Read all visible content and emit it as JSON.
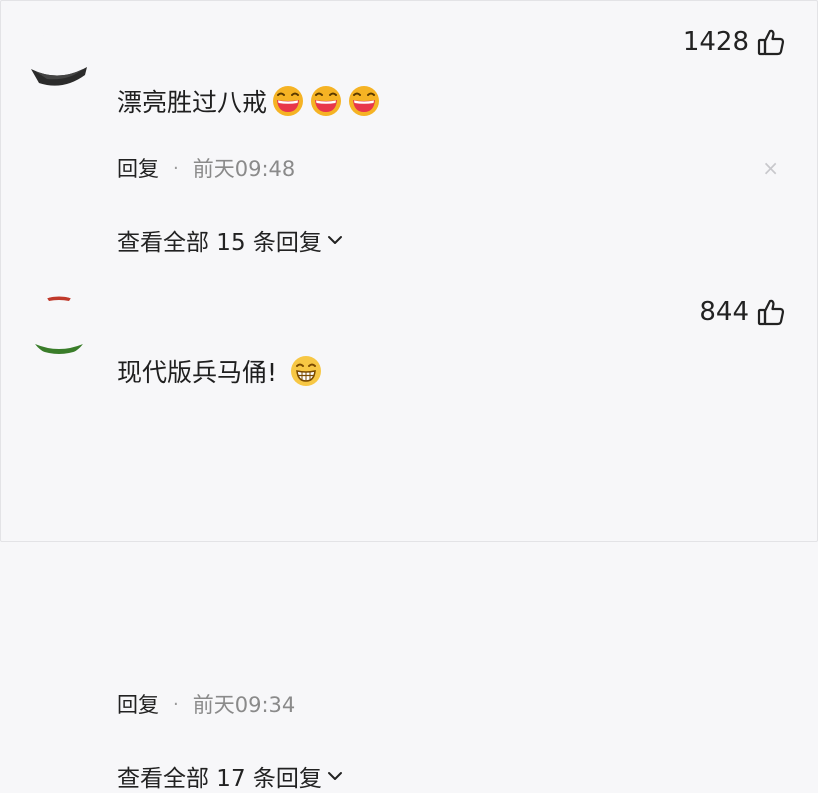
{
  "comments": [
    {
      "likes": "1428",
      "text": "漂亮胜过八戒",
      "emojis": [
        "laughing-emoji",
        "laughing-emoji",
        "laughing-emoji"
      ],
      "reply_label": "回复",
      "separator": "·",
      "time": "前天09:48",
      "close_glyph": "×",
      "view_all": "查看全部 15 条回复"
    },
    {
      "likes": "844",
      "text": "现代版兵马俑!",
      "emojis": [
        "grinning-emoji"
      ],
      "reply_label": "回复",
      "separator": "·",
      "time": "前天09:34",
      "view_all": "查看全部 17 条回复"
    }
  ],
  "icons": {
    "like": "thumbs-up-icon",
    "expand": "chevron-down-icon",
    "close": "close-icon"
  },
  "colors": {
    "background": "#f7f7f9",
    "text": "#222222",
    "meta": "#8a8a8a",
    "emoji_face": "#f5b324",
    "emoji_mouth": "#e8364a"
  }
}
